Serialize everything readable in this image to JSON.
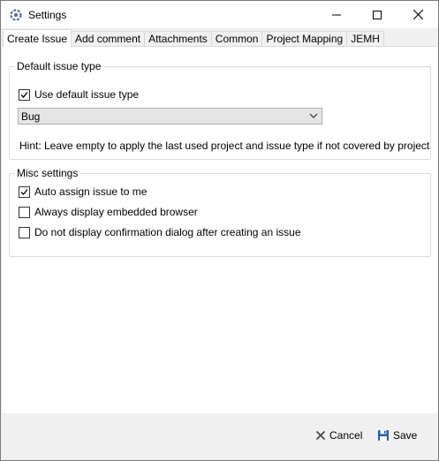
{
  "window": {
    "title": "Settings",
    "icon": "settings-app-icon"
  },
  "tabs": [
    {
      "label": "Create Issue",
      "active": true
    },
    {
      "label": "Add comment"
    },
    {
      "label": "Attachments"
    },
    {
      "label": "Common"
    },
    {
      "label": "Project Mapping"
    },
    {
      "label": "JEMH"
    }
  ],
  "default_issue_type": {
    "legend": "Default issue type",
    "use_default": {
      "label": "Use default issue type",
      "checked": true
    },
    "issue_type": {
      "value": "Bug"
    },
    "hint": "Hint: Leave empty to apply the last used project and issue type if not covered by project mapping"
  },
  "misc_settings": {
    "legend": "Misc settings",
    "options": [
      {
        "label": "Auto assign issue to me",
        "checked": true
      },
      {
        "label": "Always display embedded browser",
        "checked": false
      },
      {
        "label": "Do not display confirmation dialog after creating an issue",
        "checked": false
      }
    ]
  },
  "footer": {
    "cancel_label": "Cancel",
    "save_label": "Save",
    "cancel_color": "#4a4a4a",
    "save_color": "#1a5fb4"
  }
}
